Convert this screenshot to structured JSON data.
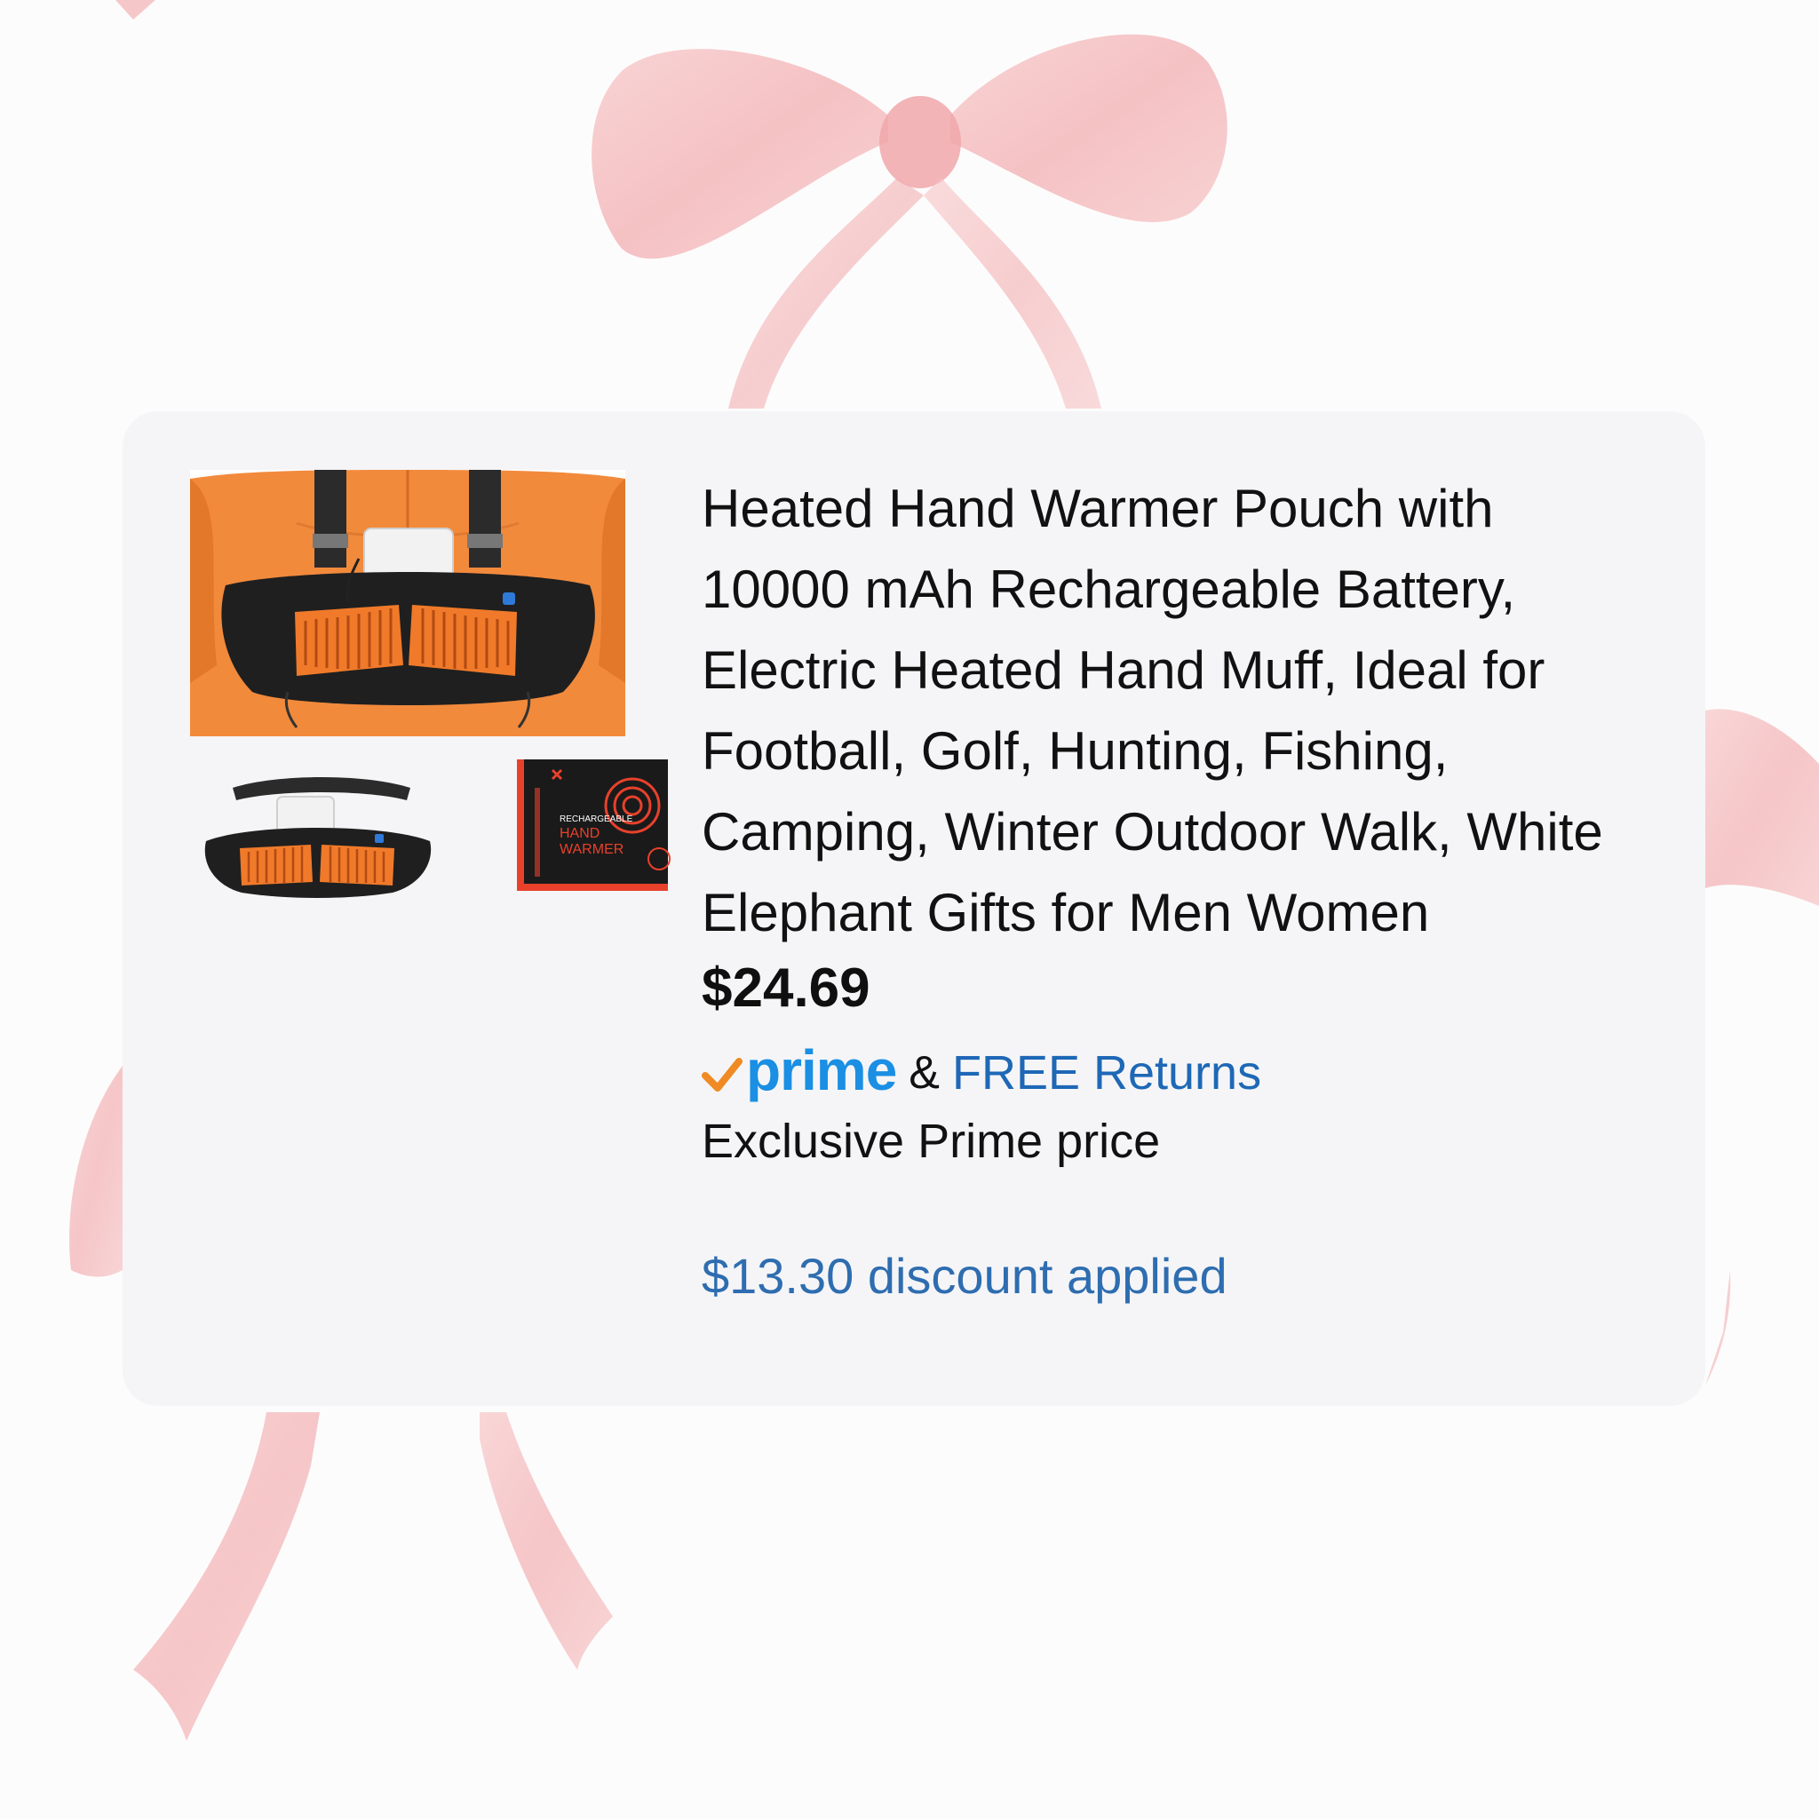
{
  "product": {
    "title": "Heated Hand Warmer Pouch with 10000 mAh Rechargeable Battery, Electric Heated Hand Muff, Ideal for Football, Golf, Hunting, Fishing, Camping, Winter Outdoor Walk, White Elephant Gifts for Men Women",
    "price": "$24.69",
    "prime_label": "prime",
    "shipping_connector": "&",
    "returns_label": "FREE Returns",
    "exclusive_label": "Exclusive Prime price",
    "discount_label": "$13.30 discount applied"
  },
  "box_text": {
    "line1": "RECHARGEABLE",
    "line2": "HAND",
    "line3": "WARMER"
  },
  "colors": {
    "card_bg": "#f5f5f7",
    "prime_blue": "#1a8fe3",
    "prime_check": "#f08a24",
    "link_blue": "#1e68b6",
    "bow_pink": "#f3b4b6",
    "heater_orange": "#f07a2a",
    "jacket_orange": "#f28a3c"
  },
  "icons": {
    "prime_check": "check-icon"
  }
}
